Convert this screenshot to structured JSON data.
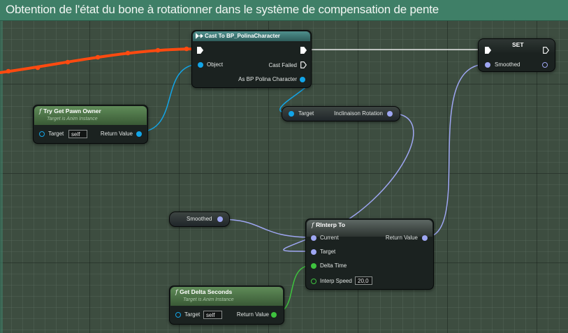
{
  "comment": {
    "title": "Obtention de l'état du bone à rotationner dans le système de compensation de pente"
  },
  "nodes": {
    "cast": {
      "title": "Cast To BP_PolinaCharacter",
      "pins": {
        "object": "Object",
        "cast_failed": "Cast Failed",
        "as_character": "As BP Polina Character"
      }
    },
    "set": {
      "title": "SET",
      "pins": {
        "smoothed": "Smoothed"
      }
    },
    "pawn_owner": {
      "title": "Try Get Pawn Owner",
      "subtitle": "Target is Anim Instance",
      "pins": {
        "target": "Target",
        "target_value": "self",
        "return_value": "Return Value"
      }
    },
    "getter": {
      "pins": {
        "target": "Target",
        "inclinaison": "Inclinaison Rotation"
      }
    },
    "smoothed_var": {
      "label": "Smoothed"
    },
    "rinterp": {
      "title": "RInterp To",
      "pins": {
        "current": "Current",
        "target": "Target",
        "delta_time": "Delta Time",
        "interp_speed": "Interp Speed",
        "interp_speed_value": "20,0",
        "return_value": "Return Value"
      }
    },
    "delta_seconds": {
      "title": "Get Delta Seconds",
      "subtitle": "Target is Anim Instance",
      "pins": {
        "target": "Target",
        "target_value": "self",
        "return_value": "Return Value"
      }
    }
  },
  "colors": {
    "comment_header": "#3f7f67",
    "exec_wire": "#ff4a10",
    "object_pin": "#12a5e8",
    "rotator_pin": "#9ea6f2",
    "float_pin": "#3ec23e"
  }
}
